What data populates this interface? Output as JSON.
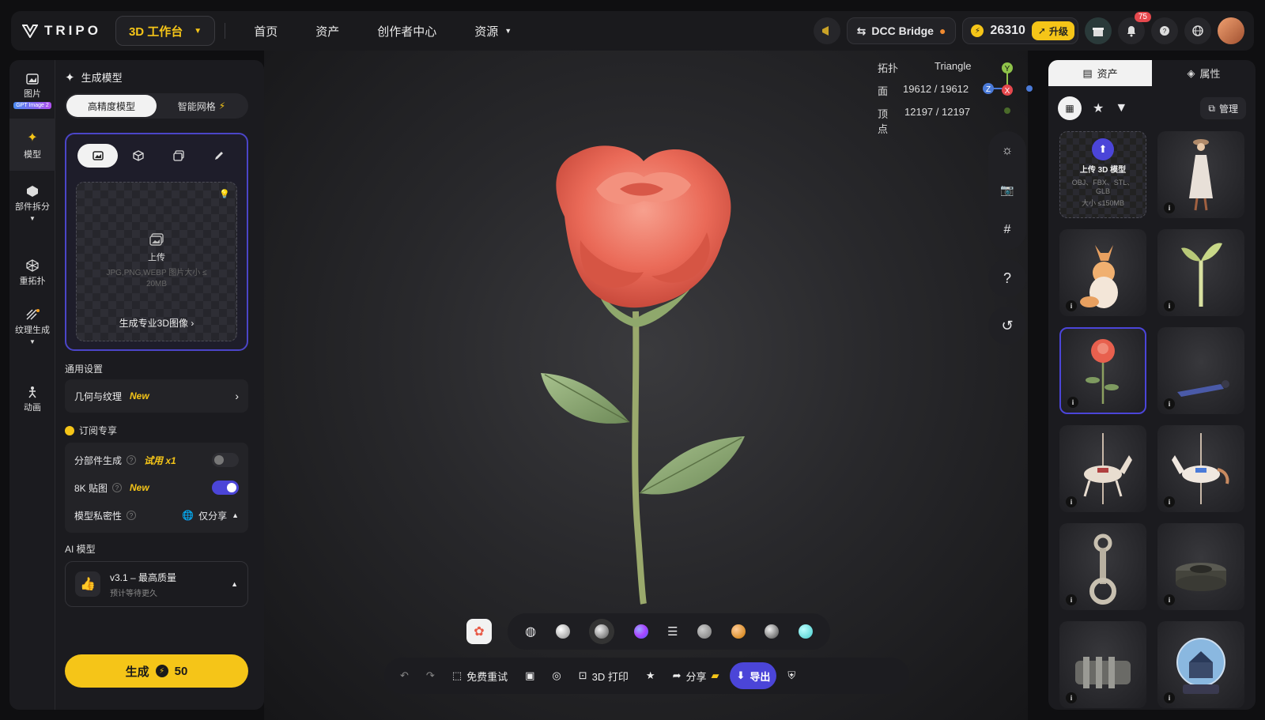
{
  "brand": {
    "name": "TRIPO"
  },
  "nav": {
    "workspace": "3D 工作台",
    "items": [
      "首页",
      "资产",
      "创作者中心",
      "资源"
    ]
  },
  "topright": {
    "dcc": "DCC Bridge",
    "credits": "26310",
    "upgrade": "升级",
    "notifications": "75"
  },
  "rail": {
    "items": [
      {
        "label": "图片",
        "badge": "GPT Image 2"
      },
      {
        "label": "模型"
      },
      {
        "label": "部件拆分"
      },
      {
        "label": "重拓扑"
      },
      {
        "label": "纹理生成"
      },
      {
        "label": "动画"
      }
    ]
  },
  "panel": {
    "title": "生成模型",
    "modes": [
      "高精度模型",
      "智能网格"
    ],
    "upload": {
      "label": "上传",
      "hint": "JPG,PNG,WEBP 图片大小 ≤ 20MB",
      "pro": "生成专业3D图像"
    },
    "general": "通用设置",
    "geometry": "几何与纹理",
    "new": "New",
    "subscribe": "订阅专享",
    "parts": "分部件生成",
    "trial": "试用 x1",
    "tex8k": "8K 贴图",
    "privacy": "模型私密性",
    "share": "仅分享",
    "ai_title": "AI 模型",
    "model_name": "v3.1 – 最高质量",
    "model_sub": "预计等待更久",
    "generate": "生成",
    "cost": "50"
  },
  "viewport": {
    "topology_label": "拓扑",
    "topology_value": "Triangle",
    "faces_label": "面",
    "faces_value": "19612 / 19612",
    "verts_label": "顶点",
    "verts_value": "12197 / 12197"
  },
  "axes": {
    "y": "Y",
    "x": "X",
    "z": "Z"
  },
  "bottombar": {
    "retry": "免费重试",
    "print": "3D 打印",
    "share": "分享",
    "export": "导出"
  },
  "assets": {
    "tabs": [
      "资产",
      "属性"
    ],
    "manage": "管理",
    "upload_title": "上传 3D 模型",
    "upload_formats": "OBJ、FBX、STL、GLB",
    "upload_size": "大小 ≤150MB",
    "info": "i"
  },
  "colors": {
    "accent": "#4b45d8",
    "yellow": "#f5c518"
  }
}
